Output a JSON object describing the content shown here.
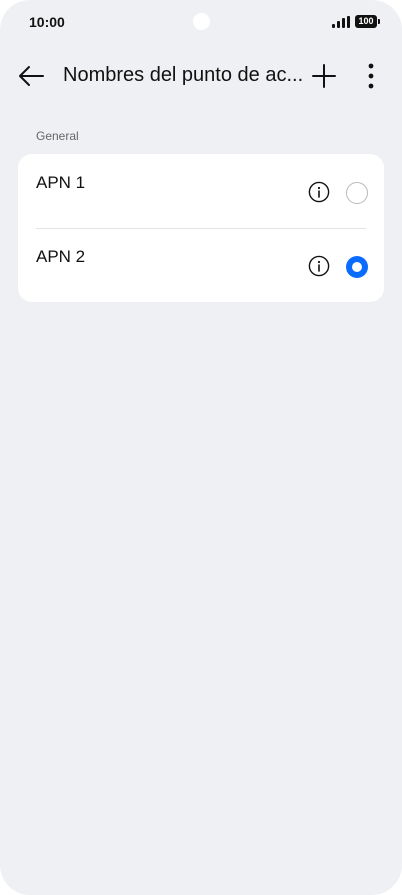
{
  "status_bar": {
    "time": "10:00",
    "battery": "100",
    "icons": [
      "signal-icon",
      "battery-icon",
      "camera-cutout"
    ]
  },
  "toolbar": {
    "title": "Nombres del punto de ac...",
    "icons": [
      "back-arrow-icon",
      "plus-icon",
      "more-vertical-icon"
    ]
  },
  "section": {
    "label": "General",
    "items": [
      {
        "label": "APN 1",
        "selected": false,
        "icon": "info-icon"
      },
      {
        "label": "APN 2",
        "selected": true,
        "icon": "info-icon"
      }
    ]
  },
  "colors": {
    "background": "#eff0f3",
    "card": "#ffffff",
    "accent": "#0a6cff"
  }
}
